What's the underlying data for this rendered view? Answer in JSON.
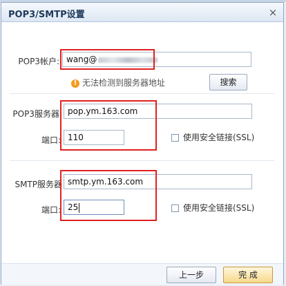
{
  "dialog": {
    "title": "POP3/SMTP设置",
    "close_label": "×"
  },
  "pop3_account": {
    "label": "POP3帐户:",
    "value_prefix": "wang@",
    "value_redacted": true
  },
  "warning": {
    "icon": "!",
    "text": "无法检测到服务器地址"
  },
  "search_button": {
    "label": "搜索"
  },
  "pop3_server": {
    "label": "POP3服务器:",
    "value": "pop.ym.163.com",
    "port_label": "端口:",
    "port_value": "110",
    "ssl_label": "使用安全链接(SSL)",
    "ssl_checked": false
  },
  "smtp_server": {
    "label": "SMTP服务器",
    "value": "smtp.ym.163.com",
    "port_label": "端口:",
    "port_value": "25",
    "ssl_label": "使用安全链接(SSL)",
    "ssl_checked": false
  },
  "footer": {
    "prev_label": "上一步",
    "finish_label": "完 成"
  },
  "colors": {
    "highlight": "#e0201f",
    "warning_icon": "#f39a1d",
    "title_text": "#1f3a5a"
  }
}
